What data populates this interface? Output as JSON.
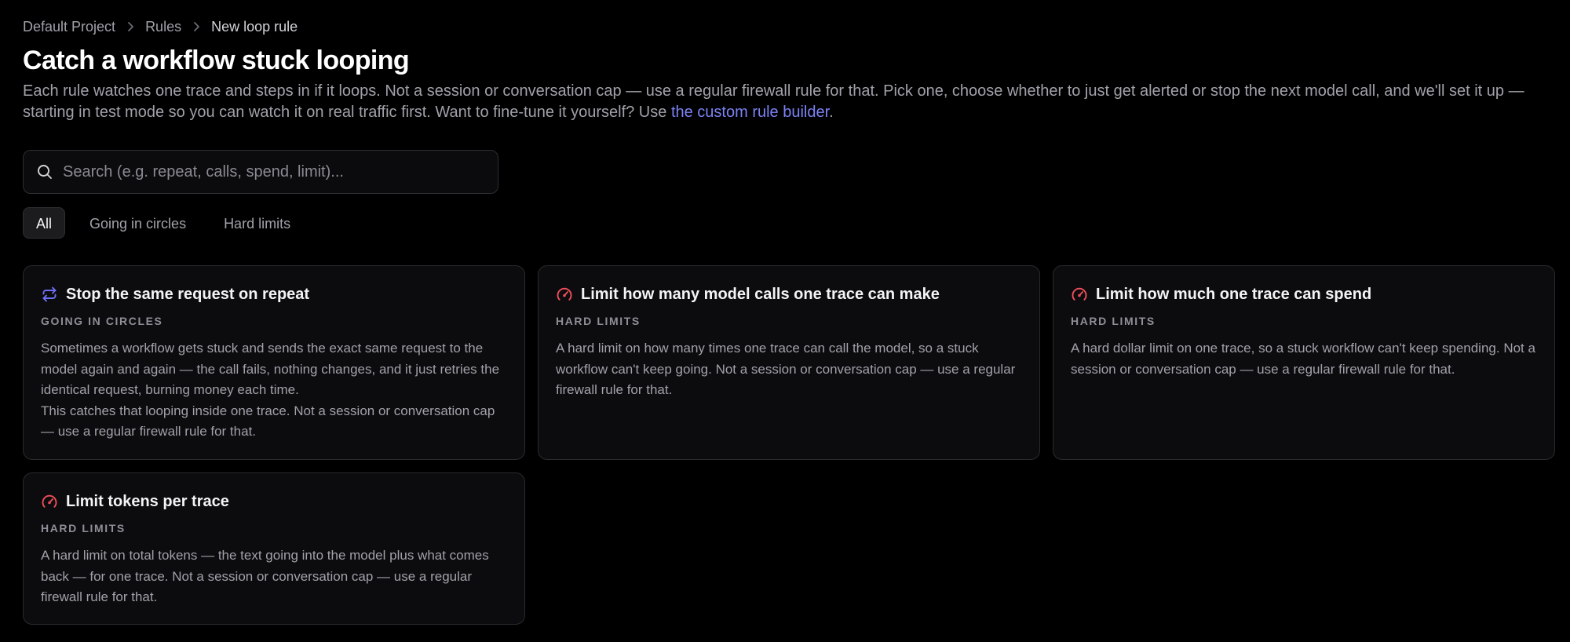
{
  "breadcrumb": {
    "items": [
      "Default Project",
      "Rules"
    ],
    "current": "New loop rule"
  },
  "header": {
    "title": "Catch a workflow stuck looping",
    "description_before": "Each rule watches one trace and steps in if it loops. Not a session or conversation cap — use a regular firewall rule for that. Pick one, choose whether to just get alerted or stop the next model call, and we'll set it up — starting in test mode so you can watch it on real traffic first. Want to fine-tune it yourself? Use ",
    "description_link": "the custom rule builder",
    "description_after": "."
  },
  "search": {
    "placeholder": "Search (e.g. repeat, calls, spend, limit)...",
    "value": "",
    "icon": "search-icon"
  },
  "filters": {
    "tabs": [
      {
        "label": "All",
        "active": true
      },
      {
        "label": "Going in circles",
        "active": false
      },
      {
        "label": "Hard limits",
        "active": false
      }
    ]
  },
  "colors": {
    "accent_link": "#7c83f5",
    "repeat_icon": "#6d6ff5",
    "limit_icon": "#ef4e5b",
    "background": "#000000",
    "card_bg": "#0c0c0e"
  },
  "cards": [
    {
      "icon": "repeat-icon",
      "title": "Stop the same request on repeat",
      "category": "GOING IN CIRCLES",
      "body_1": "Sometimes a workflow gets stuck and sends the exact same request to the model again and again — the call fails, nothing changes, and it just retries the identical request, burning money each time.",
      "body_2": "This catches that looping inside one trace. Not a session or conversation cap — use a regular firewall rule for that."
    },
    {
      "icon": "gauge-icon",
      "title": "Limit how many model calls one trace can make",
      "category": "HARD LIMITS",
      "body_1": "A hard limit on how many times one trace can call the model, so a stuck workflow can't keep going. Not a session or conversation cap — use a regular firewall rule for that."
    },
    {
      "icon": "gauge-icon",
      "title": "Limit how much one trace can spend",
      "category": "HARD LIMITS",
      "body_1": "A hard dollar limit on one trace, so a stuck workflow can't keep spending. Not a session or conversation cap — use a regular firewall rule for that."
    },
    {
      "icon": "gauge-icon",
      "title": "Limit tokens per trace",
      "category": "HARD LIMITS",
      "body_1": "A hard limit on total tokens — the text going into the model plus what comes back — for one trace. Not a session or conversation cap — use a regular firewall rule for that."
    }
  ]
}
